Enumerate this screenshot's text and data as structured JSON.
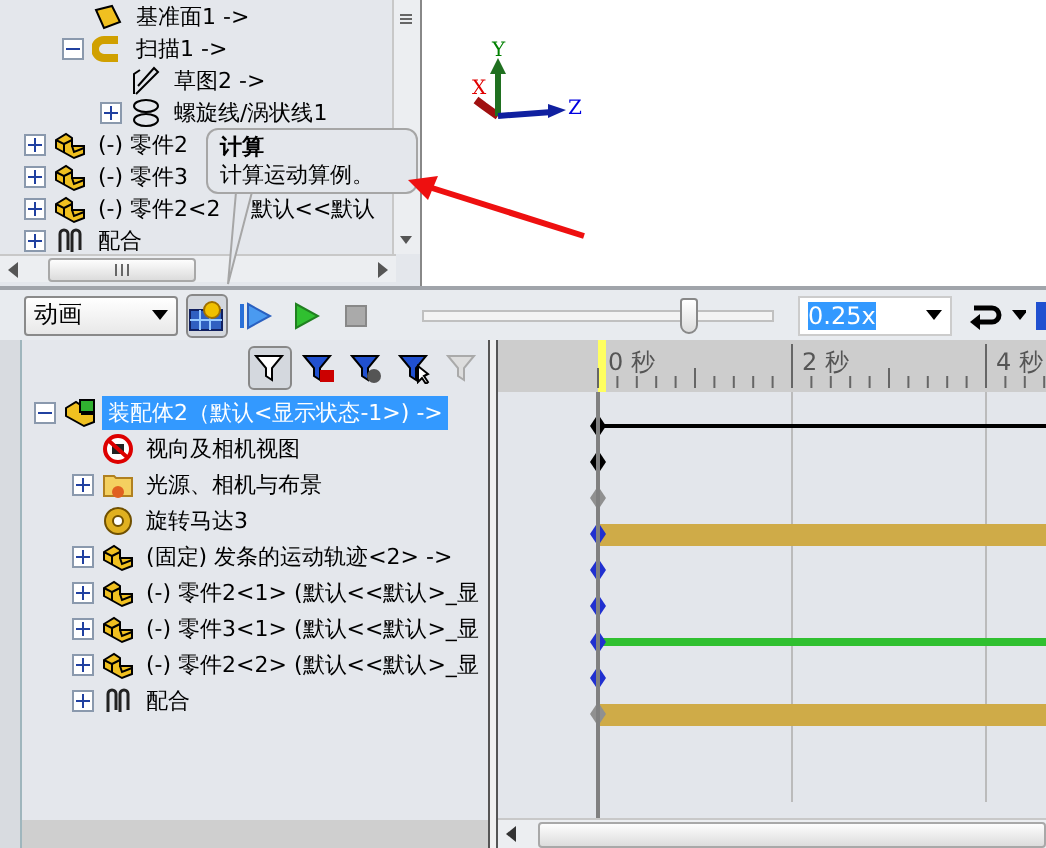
{
  "feature_tree": {
    "upper_items": [
      {
        "label": "基准面1 ->",
        "kind": "plane"
      },
      {
        "label": "扫描1 ->",
        "kind": "sweep",
        "expanded": true,
        "children": [
          {
            "label": "草图2 ->",
            "kind": "sketch"
          },
          {
            "label": "螺旋线/涡状线1",
            "kind": "helix",
            "expanded": false
          }
        ]
      }
    ],
    "items": [
      {
        "label": "(-) 零件2",
        "kind": "part",
        "expanded": false
      },
      {
        "label": "(-) 零件3",
        "kind": "part",
        "expanded": false
      },
      {
        "label": "(-) 零件2<2",
        "tail": "默认<<默认",
        "kind": "part",
        "expanded": false
      },
      {
        "label": "配合",
        "kind": "mate",
        "expanded": false
      }
    ]
  },
  "tooltip": {
    "title": "计算",
    "text": "计算运动算例。"
  },
  "triad": {
    "x": "X",
    "y": "Y",
    "z": "Z"
  },
  "toolbar": {
    "study_type": "动画",
    "slider": {
      "level": 0.76
    },
    "speed": "0.25x"
  },
  "motion_tree": {
    "items": [
      {
        "label": "装配体2（默认<显示状态-1>) ->",
        "kind": "assembly",
        "expanded": true,
        "selected": true,
        "children": [
          {
            "label": "视向及相机视图",
            "kind": "camera-off",
            "selected": false
          },
          {
            "label": "光源、相机与布景",
            "kind": "folder",
            "expanded": false,
            "selected": false
          },
          {
            "label": "旋转马达3",
            "kind": "motor",
            "selected": false
          },
          {
            "label": "(固定) 发条的运动轨迹<2> ->",
            "kind": "part",
            "expanded": false,
            "selected": false
          },
          {
            "label": "(-) 零件2<1> (默认<<默认>_显",
            "kind": "part",
            "expanded": false,
            "selected": false
          },
          {
            "label": "(-) 零件3<1> (默认<<默认>_显",
            "kind": "part",
            "expanded": false,
            "selected": false
          },
          {
            "label": "(-) 零件2<2> (默认<<默认>_显",
            "kind": "part",
            "expanded": false,
            "selected": false
          },
          {
            "label": "配合",
            "kind": "mate",
            "expanded": false,
            "selected": false
          }
        ]
      }
    ]
  },
  "timeline": {
    "ticks": [
      "0 秒",
      "2 秒",
      "4 秒"
    ],
    "tracks": [
      {
        "kind": "thin",
        "color": "#000000"
      },
      {
        "kind": "none",
        "color": "#000000"
      },
      {
        "kind": "none",
        "color": "#909090"
      },
      {
        "kind": "band",
        "color": "#2030d0"
      },
      {
        "kind": "none",
        "color": "#2030d0"
      },
      {
        "kind": "none",
        "color": "#2030d0"
      },
      {
        "kind": "strip",
        "color": "#2030d0"
      },
      {
        "kind": "none",
        "color": "#2030d0"
      },
      {
        "kind": "band",
        "color": "#909090"
      }
    ]
  }
}
